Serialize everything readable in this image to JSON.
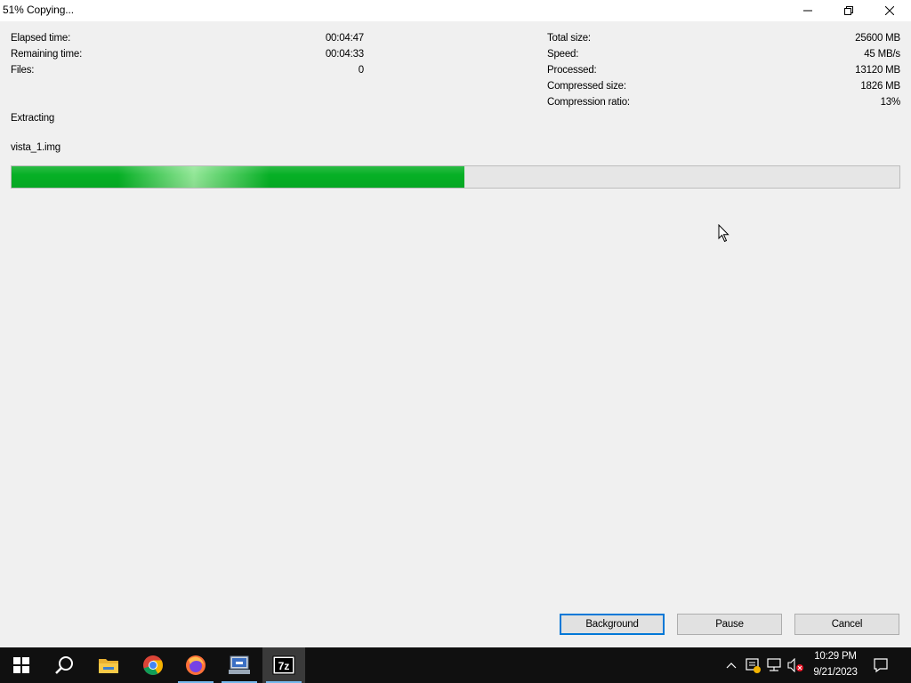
{
  "window": {
    "title": "51% Copying..."
  },
  "stats_left": [
    {
      "label": "Elapsed time:",
      "value": "00:04:47"
    },
    {
      "label": "Remaining time:",
      "value": "00:04:33"
    },
    {
      "label": "Files:",
      "value": "0"
    }
  ],
  "stats_right": [
    {
      "label": "Total size:",
      "value": "25600 MB"
    },
    {
      "label": "Speed:",
      "value": "45 MB/s"
    },
    {
      "label": "Processed:",
      "value": "13120 MB"
    },
    {
      "label": "Compressed size:",
      "value": "1826 MB"
    },
    {
      "label": "Compression ratio:",
      "value": "13%"
    }
  ],
  "status": "Extracting",
  "current_file": "vista_1.img",
  "progress": {
    "fraction": 0.51,
    "color": "#06b025"
  },
  "buttons": {
    "background": "Background",
    "pause": "Pause",
    "cancel": "Cancel"
  },
  "taskbar": {
    "apps": [
      "start-icon",
      "search-icon",
      "file-explorer-icon",
      "chrome-icon",
      "firefox-icon",
      "network-app-icon",
      "7zip-icon"
    ],
    "tray": {
      "time": "10:29 PM",
      "date": "9/21/2023"
    }
  }
}
